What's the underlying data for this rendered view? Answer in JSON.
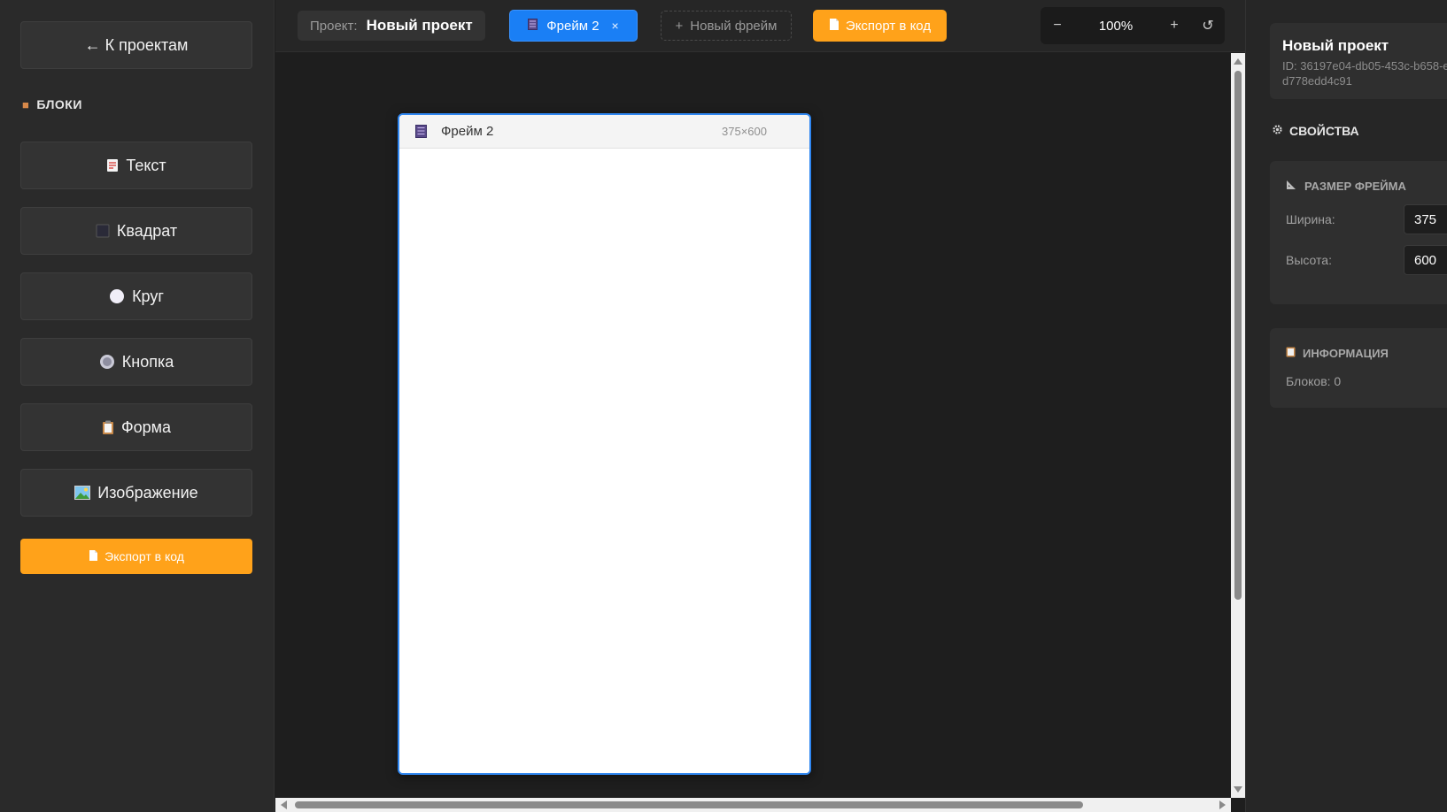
{
  "sidebar": {
    "back_label": "← К проектам",
    "section_title": "БЛОКИ",
    "blocks": [
      {
        "label": "Текст",
        "icon": "page-icon"
      },
      {
        "label": "Квадрат",
        "icon": "square-icon"
      },
      {
        "label": "Круг",
        "icon": "circle-icon"
      },
      {
        "label": "Кнопка",
        "icon": "button-dot-icon"
      },
      {
        "label": "Форма",
        "icon": "clipboard-icon"
      },
      {
        "label": "Изображение",
        "icon": "picture-icon"
      }
    ],
    "export_label": "Экспорт в код"
  },
  "toolbar": {
    "project_label": "Проект:",
    "project_name": "Новый проект",
    "active_tab": "Фрейм 2",
    "tab_close": "×",
    "new_frame_plus": "+",
    "new_frame_label": "Новый фрейм",
    "export_label": "Экспорт в код",
    "zoom_out": "−",
    "zoom_value": "100%",
    "zoom_in": "+",
    "reset": "↺"
  },
  "canvas": {
    "frame_title": "Фрейм 2",
    "frame_size": "375×600"
  },
  "panel": {
    "project_name": "Новый проект",
    "project_id": "ID: 36197e04-db05-453c-b658-ed778edd4c91",
    "properties_title": "СВОЙСТВА",
    "frame_size_title": "РАЗМЕР ФРЕЙМА",
    "width_label": "Ширина:",
    "width_value": "375",
    "height_label": "Высота:",
    "height_value": "600",
    "info_title": "ИНФОРМАЦИЯ",
    "blocks_count": "Блоков: 0"
  },
  "colors": {
    "accent_blue": "#1a7ff5",
    "accent_orange": "#ffa21a",
    "frame_border": "#2f86f0"
  }
}
